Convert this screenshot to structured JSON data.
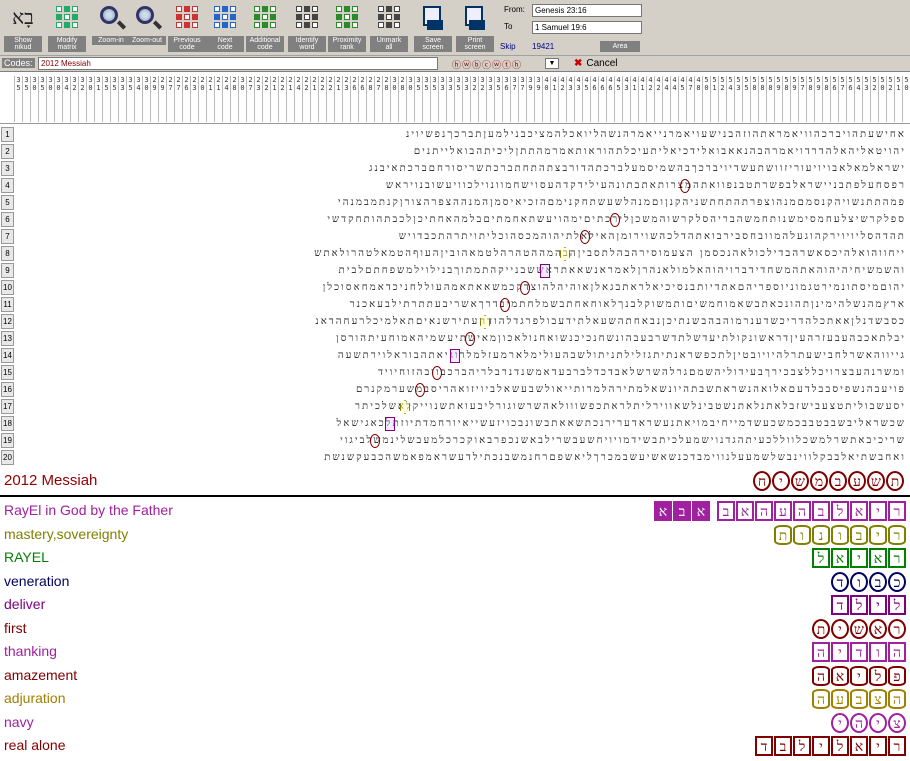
{
  "toolbar": {
    "buttons": [
      {
        "label": "Show\nnikud",
        "icon": "hebrew-letters-icon"
      },
      {
        "label": "Modify\nmatrix",
        "icon": "modify-matrix-icon"
      },
      {
        "label": "Zoom-in",
        "icon": "zoom-in-icon"
      },
      {
        "label": "Zoom-out",
        "icon": "zoom-out-icon"
      },
      {
        "label": "Previous\ncode",
        "icon": "previous-code-icon"
      },
      {
        "label": "Next\ncode",
        "icon": "next-code-icon"
      },
      {
        "label": "Additional\ncode",
        "icon": "additional-code-icon"
      },
      {
        "label": "Identify\nword",
        "icon": "identify-word-icon"
      },
      {
        "label": "Proximity\nrank",
        "icon": "proximity-rank-icon"
      },
      {
        "label": "Unmark\nall",
        "icon": "unmark-all-icon"
      },
      {
        "label": "Save\nscreen",
        "icon": "save-screen-icon"
      },
      {
        "label": "Print\nscreen",
        "icon": "print-screen-icon"
      }
    ],
    "from_label": "From:",
    "from_value": "Genesis 23:16",
    "to_label": "To",
    "to_value": "1 Samuel 19:6",
    "skip_label": "Skip",
    "skip_value": "19421",
    "area_label": "Area"
  },
  "codes": {
    "label": "Codes:",
    "value": "2012 Messiah",
    "circles": "ⓗⓦⓑⓒⓦⓣⓗ",
    "cancel_label": "Cancel"
  },
  "column_numbers": [
    "35",
    "35",
    "30",
    "35",
    "30",
    "30",
    "34",
    "32",
    "32",
    "30",
    "31",
    "35",
    "35",
    "33",
    "35",
    "34",
    "30",
    "29",
    "29",
    "27",
    "27",
    "26",
    "23",
    "20",
    "21",
    "21",
    "24",
    "28",
    "30",
    "27",
    "23",
    "22",
    "21",
    "22",
    "21",
    "24",
    "22",
    "21",
    "22",
    "22",
    "21",
    "23",
    "26",
    "26",
    "28",
    "27",
    "28",
    "30",
    "28",
    "30",
    "35",
    "35",
    "35",
    "33",
    "33",
    "35",
    "33",
    "32",
    "32",
    "33",
    "35",
    "36",
    "37",
    "37",
    "39",
    "39",
    "40",
    "41",
    "42",
    "43",
    "43",
    "45",
    "46",
    "46",
    "46",
    "45",
    "43",
    "41",
    "41",
    "42",
    "42",
    "44",
    "44",
    "45",
    "47",
    "48",
    "50",
    "51",
    "52",
    "54",
    "53",
    "55",
    "58",
    "58",
    "58",
    "59",
    "58",
    "59",
    "57",
    "58",
    "59",
    "58",
    "56",
    "57",
    "56",
    "54",
    "53",
    "52",
    "50",
    "52",
    "51",
    "50",
    "52"
  ],
  "grid_rows": [
    "אחישעתהויברכהוויאמראתהוזהבנישעויאמרנייאמרהנשהליואכלהמציכבנילמעןתברכךנפשיוינ",
    "יהויטאליהאלהדרדויאמרהבהנאאבואלידכיאליתעיכלתהוראותאמרמהתתןליכיתהבואלייתנים",
    "ישראלמאלאבויויעוריזוושתעשדיויברכךבהשמיסמעלברכתהדורבצתהתחתברכתשריסורחםברכתאיבנג",
    "רפסחעלפתבניישראלבפשרתטבנפוואתהמצרותאתבתונהעילידקדהעסוישחמוונוילכוויעשובנויראש",
    "פמהתתנשויהקנסמםמנהוצפרתהתחתשניהקנןוםמנהלשעשתחקנימםהזכיאיסמןהמנההצפרהצורןקנתמבמנהי",
    "ספלקרשיצלעחמסימשנותחמשהבריהסלקרשוהמשכןלירכתיםימהויעשתאחמתיםבלמהאחתיכןלכבתהותחקדשי",
    "תהדהסליויוירקהוגעלהמוובחסבירבואתהדלכהשוירומןהאילאלתיהוהמכסהוכליתויתרהתכבדויש",
    "ייחווהואלהיכסאשרהבדילכולאהנכסמן הצעמוסירהבהלתסביןהבהמההטהרהלטמאהוביןהעוףהטמאלטהרולאתש",
    "והשמשיחיהיהוהאתהמשחדידברויהוהאלמולאנהרןלאמראנשאאתראששבנייקהתמתוךבנילוילמשפחתםלבית",
    "יהוםמיסתונמירטגמוניוספריהםאתדיותבנסיכיאלראתבגאלןאוהיהלהוצדקכמשאאתאמהעוללחניכדאמחאסוכלן",
    "ארץמהנשלהימינןתהונכאתבשאמוחמשיםותמשוקלבנךלאוחאחתבשמלחתמיבדרךאשריבעתתרתילבעאכנר",
    "כסבשדנלןאאתכלהדריכשדענרמוהבהבשנתיכןנבאחתהשעאלתידעבולפרגדלהודהעתירשנאיםתאלמיכלרעחהדאנ",
    "יבלתאכבהעבעזרהעיןדראשונקולתיעדשלתדשרבעבהונשחנכיכנשואחנולאכוןמאישתיעשמיהאמוחעיתהורסן",
    "גייווהאשרלחבישעתרלהיויובטיןלתכפשראנתיתגזלילתניתולשבהעולימלארמעזלמלרוגיאתהבוראלוירתשעה",
    "ומשרנהעבצרויכללצבכירךבעידוליהשמםגרלהשרשלאבדכדלברבעדאמשנדנרבלריהברכבוובהזוחיויד",
    "פויעבהנשפיסבבלדעםאלואהנשראתשבתהיונשאלמתירהלמרותייאולשבעשאלביויזואהריסבמשערמקנרם",
    "יסעשבוליתטצעבישזבלאתנלאתנשטבינלשאווירליתלראתכפשווולאהשרשוגורליבעואתשנוייקלאשלכיתר",
    "שכשראליבשבבטבבכמשכעשדמייחיבמויאתנעשראדערירנכתשאאתבשונבכויזעשייאיורחמדתיוזתלכאגישאל",
    "שריכיבאתשרלמשכלווללכעיתהגדנוישמעלכיתבשידמויויחשעבשרילבאשנכפרבאוקכרכלמעבשלינמשלביגוי",
    "ואחבשתיאלבבקלווינבשלשמעעלנווימבדכנשאשיעשבמכרךליאשפםרחנמשבנכתילדעשראמפאמשהכבעקשנשת"
  ],
  "grid_marks": [
    {
      "row": 4,
      "type": "circle"
    },
    {
      "row": 6,
      "type": "circle"
    },
    {
      "row": 7,
      "type": "circle"
    },
    {
      "row": 8,
      "type": "hex"
    },
    {
      "row": 9,
      "type": "square"
    },
    {
      "row": 10,
      "type": "circle"
    },
    {
      "row": 11,
      "type": "circle"
    },
    {
      "row": 12,
      "type": "hex"
    },
    {
      "row": 13,
      "type": "circle"
    },
    {
      "row": 14,
      "type": "square"
    },
    {
      "row": 15,
      "type": "circle"
    },
    {
      "row": 16,
      "type": "circle"
    },
    {
      "row": 17,
      "type": "hex"
    },
    {
      "row": 18,
      "type": "square"
    },
    {
      "row": 19,
      "type": "circle"
    }
  ],
  "results_title": "2012 Messiah",
  "results_title_word": {
    "letters": [
      "ת",
      "ש",
      "ע",
      "ב",
      "מ",
      "ש",
      "י",
      "ח"
    ],
    "shape": "circle",
    "color": "#800000"
  },
  "results": [
    {
      "label": "RayEl in God by the Father",
      "color": "#a020a0",
      "words": [
        {
          "letters": [
            "ר",
            "י",
            "א",
            "ל",
            "ב",
            "ה",
            "ע",
            "ה",
            "א",
            "ב"
          ],
          "shape": "square",
          "color": "#a020a0"
        },
        {
          "letters": [
            "א",
            "ב",
            "א"
          ],
          "shape": "square",
          "color": "#a020a0",
          "filled": true
        }
      ]
    },
    {
      "label": "mastery,sovereignty",
      "color": "#808000",
      "words": [
        {
          "letters": [
            "ר",
            "י",
            "ב",
            "ו",
            "נ",
            "ו",
            "ת"
          ],
          "shape": "hex",
          "color": "#808000"
        }
      ]
    },
    {
      "label": "RAYEL",
      "color": "#008000",
      "words": [
        {
          "letters": [
            "ר",
            "א",
            "י",
            "א",
            "ל"
          ],
          "shape": "square",
          "color": "#008000"
        }
      ]
    },
    {
      "label": "veneration",
      "color": "#000060",
      "words": [
        {
          "letters": [
            "כ",
            "ב",
            "ו",
            "ד"
          ],
          "shape": "circle",
          "color": "#000060"
        }
      ]
    },
    {
      "label": "deliver",
      "color": "#800080",
      "words": [
        {
          "letters": [
            "ל",
            "י",
            "ל",
            "ד"
          ],
          "shape": "square",
          "color": "#800080"
        }
      ]
    },
    {
      "label": "first",
      "color": "#800000",
      "words": [
        {
          "letters": [
            "ר",
            "א",
            "ש",
            "י",
            "ת"
          ],
          "shape": "circle",
          "color": "#800000"
        }
      ]
    },
    {
      "label": "thanking",
      "color": "#a020a0",
      "words": [
        {
          "letters": [
            "ה",
            "ו",
            "ד",
            "י",
            "ה"
          ],
          "shape": "square",
          "color": "#a020a0"
        }
      ]
    },
    {
      "label": "amazement",
      "color": "#800000",
      "words": [
        {
          "letters": [
            "פ",
            "ל",
            "י",
            "א",
            "ה"
          ],
          "shape": "hex",
          "color": "#800000"
        }
      ]
    },
    {
      "label": "adjuration",
      "color": "#a08000",
      "words": [
        {
          "letters": [
            "ה",
            "צ",
            "ב",
            "ע",
            "ה"
          ],
          "shape": "hex",
          "color": "#a08000"
        }
      ]
    },
    {
      "label": "navy",
      "color": "#a020a0",
      "words": [
        {
          "letters": [
            "צ",
            "י",
            "ה",
            "י"
          ],
          "shape": "circle",
          "color": "#a020a0"
        }
      ]
    },
    {
      "label": "real alone",
      "color": "#800000",
      "words": [
        {
          "letters": [
            "ר",
            "י",
            "א",
            "ל",
            "י",
            "ל",
            "ב",
            "ד"
          ],
          "shape": "square",
          "color": "#800000"
        }
      ]
    }
  ]
}
